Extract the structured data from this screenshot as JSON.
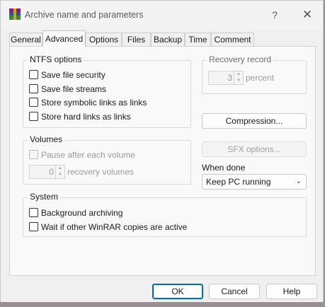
{
  "window": {
    "title": "Archive name and parameters",
    "help_glyph": "?",
    "close_glyph": "✕"
  },
  "tabs": [
    {
      "label": "General"
    },
    {
      "label": "Advanced"
    },
    {
      "label": "Options"
    },
    {
      "label": "Files"
    },
    {
      "label": "Backup"
    },
    {
      "label": "Time"
    },
    {
      "label": "Comment"
    }
  ],
  "active_tab": "Advanced",
  "ntfs": {
    "title": "NTFS options",
    "items": [
      {
        "label": "Save file security",
        "checked": false
      },
      {
        "label": "Save file streams",
        "checked": false
      },
      {
        "label": "Store symbolic links as links",
        "checked": false
      },
      {
        "label": "Store hard links as links",
        "checked": false
      }
    ]
  },
  "recovery": {
    "title": "Recovery record",
    "value": "3",
    "unit": "percent",
    "enabled": false
  },
  "compression_button": "Compression...",
  "sfx_button": "SFX options...",
  "volumes": {
    "title": "Volumes",
    "pause_label": "Pause after each volume",
    "recovery_value": "0",
    "recovery_label": "recovery volumes",
    "enabled": false
  },
  "when_done": {
    "label": "When done",
    "selected": "Keep PC running"
  },
  "system": {
    "title": "System",
    "items": [
      {
        "label": "Background archiving",
        "checked": false
      },
      {
        "label": "Wait if other WinRAR copies are active",
        "checked": false
      }
    ]
  },
  "footer": {
    "ok": "OK",
    "cancel": "Cancel",
    "help": "Help"
  },
  "colors": {
    "accent": "#0067c0",
    "dialog_bg": "#f0f0f0",
    "disabled_text": "#9a9a9a"
  },
  "icons": [
    "winrar-app-icon",
    "help-icon",
    "close-icon",
    "spin-up-icon",
    "spin-down-icon",
    "chevron-down-icon"
  ]
}
